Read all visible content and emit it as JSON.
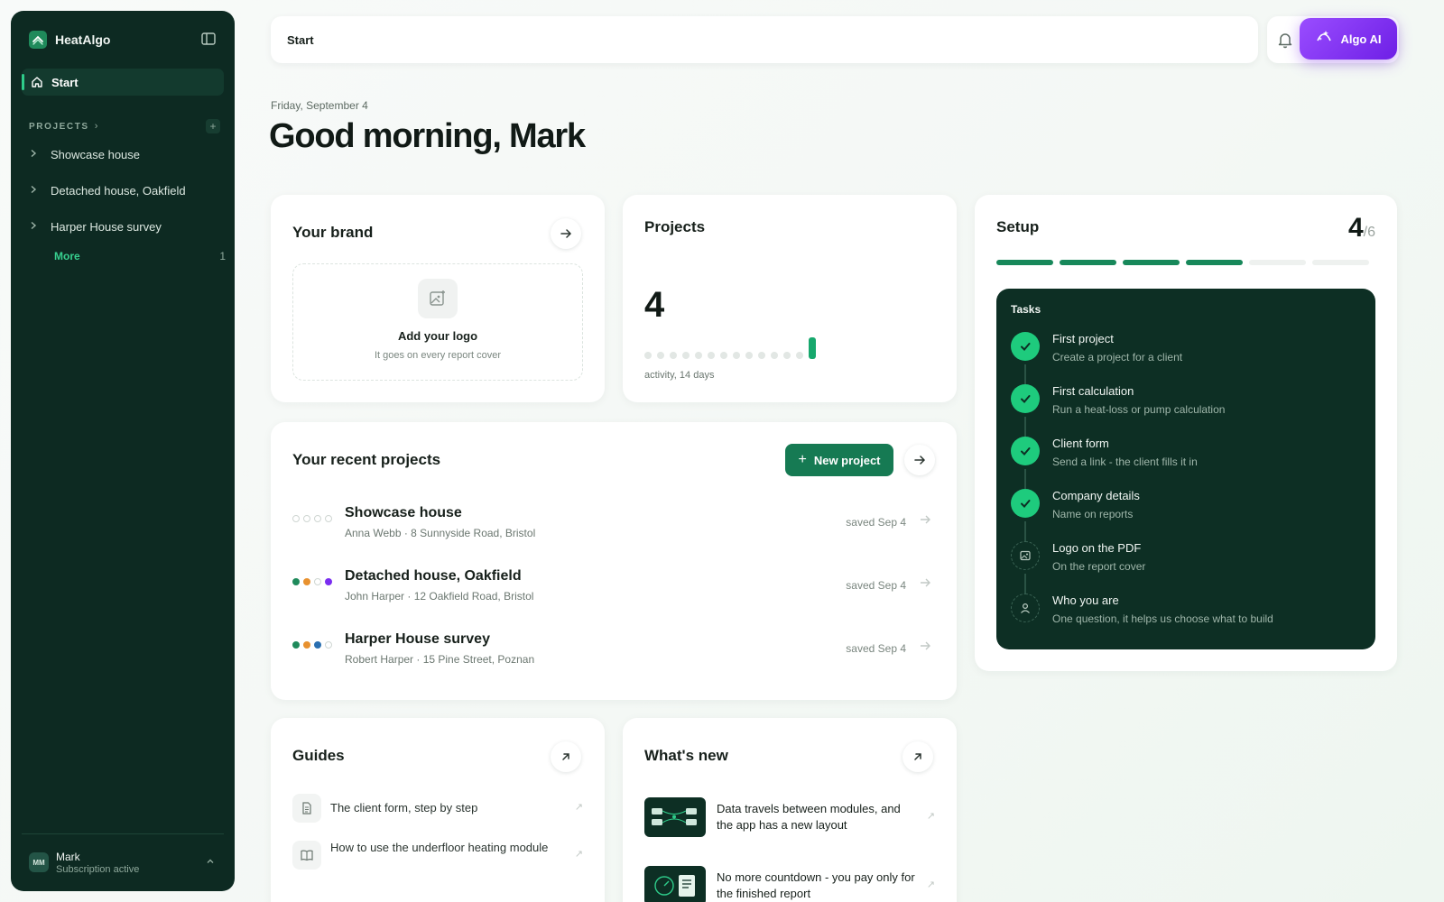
{
  "app": {
    "name": "HeatAlgo"
  },
  "sidebar": {
    "nav_start": "Start",
    "projects_label": "PROJECTS",
    "projects_chevron": "›",
    "add_symbol": "+",
    "projects": [
      "Showcase house",
      "Detached house, Oakfield",
      "Harper House survey"
    ],
    "more_label": "More",
    "more_count": "1",
    "user": {
      "initials": "MM",
      "name": "Mark",
      "status": "Subscription active"
    }
  },
  "topbar": {
    "breadcrumb": "Start",
    "ai_button": "Algo AI"
  },
  "greeting": {
    "date": "Friday, September 4",
    "title": "Good morning, Mark"
  },
  "brand_card": {
    "title": "Your brand",
    "logo_title": "Add your logo",
    "logo_subtitle": "It goes on every report cover"
  },
  "projects_card": {
    "title": "Projects",
    "count": "4",
    "activity_label": "activity, 14 days",
    "activity": [
      0,
      0,
      0,
      0,
      0,
      0,
      0,
      0,
      0,
      0,
      0,
      0,
      0,
      1
    ]
  },
  "setup_card": {
    "title": "Setup",
    "done": "4",
    "total": "/6",
    "steps_done": 4,
    "steps_total": 6,
    "tasks_label": "Tasks",
    "tasks": [
      {
        "title": "First project",
        "subtitle": "Create a project for a client",
        "done": true,
        "icon": "check-icon"
      },
      {
        "title": "First calculation",
        "subtitle": "Run a heat-loss or pump calculation",
        "done": true,
        "icon": "check-icon"
      },
      {
        "title": "Client form",
        "subtitle": "Send a link - the client fills it in",
        "done": true,
        "icon": "check-icon"
      },
      {
        "title": "Company details",
        "subtitle": "Name on reports",
        "done": true,
        "icon": "check-icon"
      },
      {
        "title": "Logo on the PDF",
        "subtitle": "On the report cover",
        "done": false,
        "icon": "image-icon"
      },
      {
        "title": "Who you are",
        "subtitle": "One question, it helps us choose what to build",
        "done": false,
        "icon": "user-icon"
      }
    ]
  },
  "recent_card": {
    "title": "Your recent projects",
    "new_button": "New project",
    "new_button_icon": "+",
    "rows": [
      {
        "name": "Showcase house",
        "subtitle": "Anna Webb · 8 Sunnyside Road, Bristol",
        "saved": "saved Sep 4",
        "progress": [
          "empty",
          "empty",
          "empty",
          "empty"
        ]
      },
      {
        "name": "Detached house, Oakfield",
        "subtitle": "John Harper · 12 Oakfield Road, Bristol",
        "saved": "saved Sep 4",
        "progress": [
          "#1f8a5b",
          "#e8912f",
          "empty",
          "#7a2df0"
        ]
      },
      {
        "name": "Harper House survey",
        "subtitle": "Robert Harper · 15 Pine Street, Poznan",
        "saved": "saved Sep 4",
        "progress": [
          "#1f8a5b",
          "#e8912f",
          "#2a6fb0",
          "empty"
        ]
      }
    ]
  },
  "guides_card": {
    "title": "Guides",
    "items": [
      "The client form, step by step",
      "How to use the underfloor heating module"
    ]
  },
  "news_card": {
    "title": "What's new",
    "items": [
      "Data travels between modules, and the app has a new layout",
      "No more countdown - you pay only for the finished report"
    ]
  },
  "colors": {
    "accent": "#17a86d",
    "sidebar_bg": "#0d2a22",
    "tasks_bg": "#0d2f24",
    "ai_purple": "#8a3ff5"
  }
}
